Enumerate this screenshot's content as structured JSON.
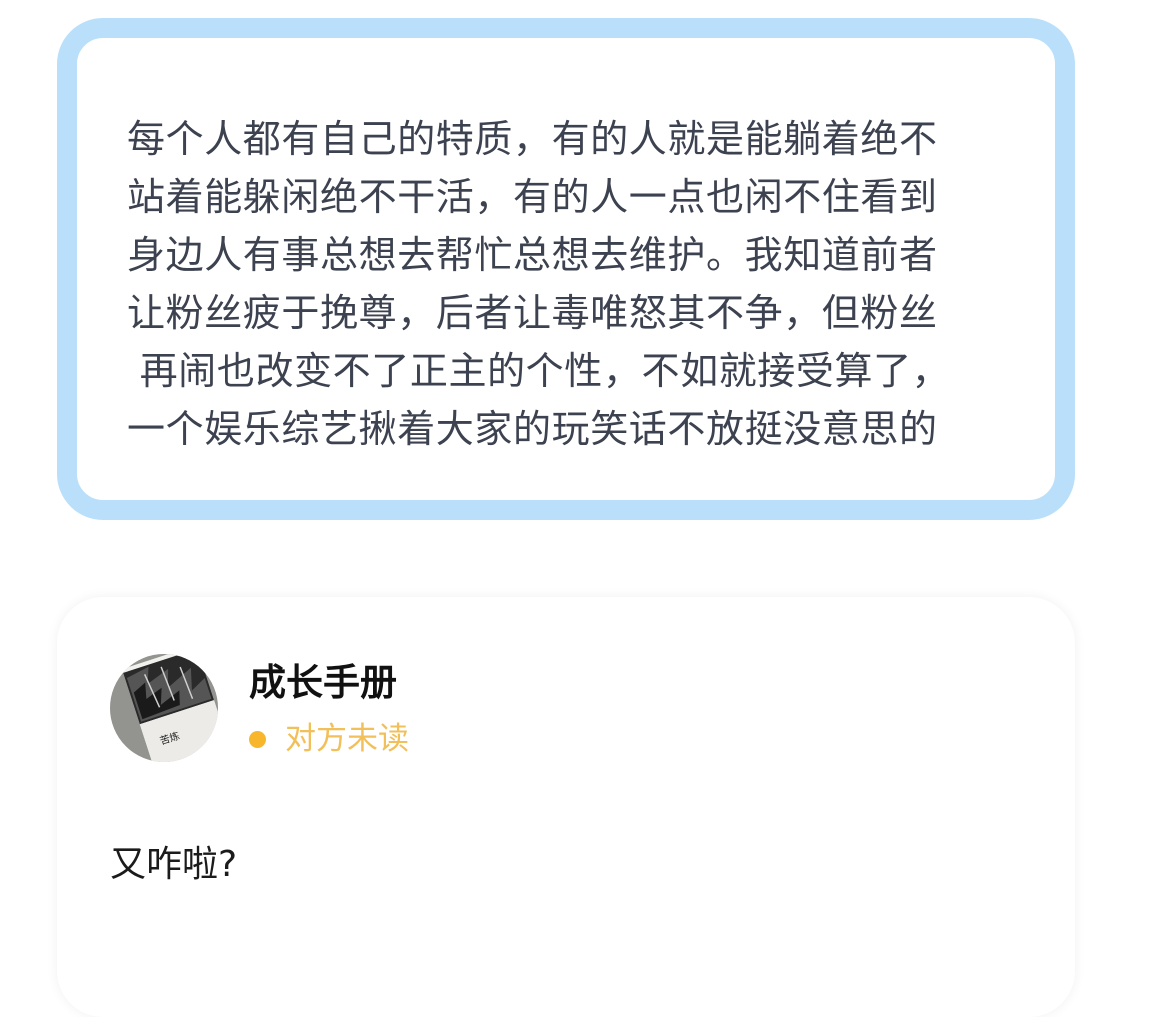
{
  "quote": {
    "lines": [
      "每个人都有自己的特质，有的人就是能躺着绝不",
      "站着能躲闲绝不干活，有的人一点也闲不住看到",
      "身边人有事总想去帮忙总想去维护。我知道前者",
      "让粉丝疲于挽尊，后者让毒唯怒其不争，但粉丝",
      " 再闹也改变不了正主的个性，不如就接受算了，",
      "一个娱乐综艺揪着大家的玩笑话不放挺没意思的"
    ]
  },
  "reply": {
    "sender_name": "成长手册",
    "status_text": "对方未读",
    "message": "又咋啦?",
    "avatar": {
      "icon": "book-avatar-icon",
      "book_title": "苦炼"
    }
  },
  "colors": {
    "quote_border": "#b9dffa",
    "quote_text": "#3d4250",
    "status_dot": "#f7b62b",
    "status_text": "#f2c05a",
    "name_text": "#111111"
  }
}
